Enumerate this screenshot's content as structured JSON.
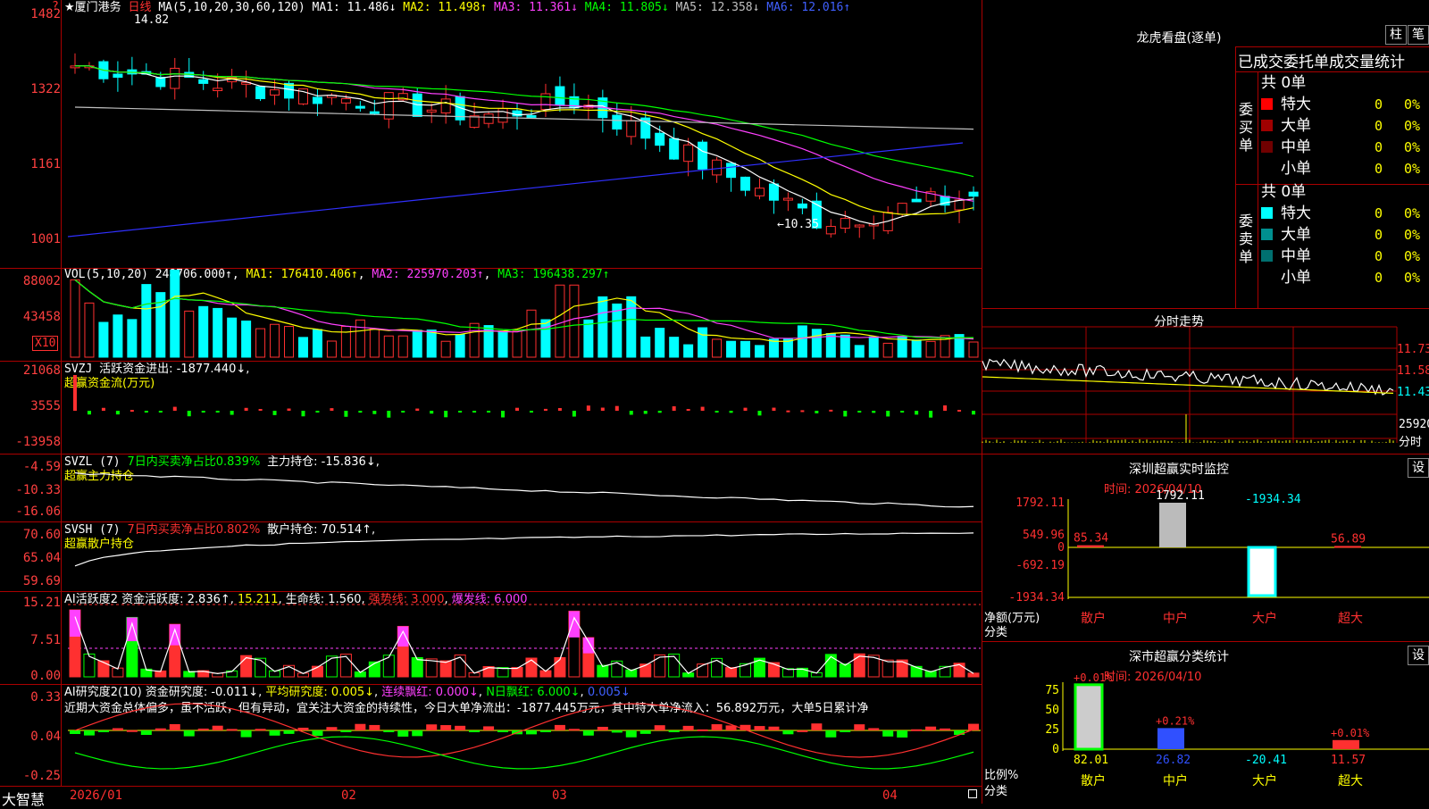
{
  "main_chart": {
    "title": "★厦门港务",
    "period": "日线",
    "ma_header": "MA(5,10,20,30,60,120)",
    "ma_values": [
      {
        "label": "MA1: 11.486↓",
        "color": "#ffffff"
      },
      {
        "label": "MA2: 11.498↑",
        "color": "#ffff00"
      },
      {
        "label": "MA3: 11.361↓",
        "color": "#ff40ff"
      },
      {
        "label": "MA4: 11.805↓",
        "color": "#00ff00"
      },
      {
        "label": "MA5: 12.358↓",
        "color": "#c0c0c0"
      },
      {
        "label": "MA6: 12.016↑",
        "color": "#4060ff"
      }
    ],
    "axis_labels": [
      "1482",
      "1322",
      "1161",
      "1001"
    ],
    "high_annotation": "14.82",
    "low_annotation": "←10.35"
  },
  "volume_pane": {
    "header": "VOL(5,10,20)",
    "value": "248706.000↑",
    "ma1": "MA1: 176410.406↑",
    "ma2": "MA2: 225970.203↑",
    "ma3": "MA3: 196438.297↑",
    "axis_labels": [
      "88002",
      "43458"
    ],
    "multiplier": "X10"
  },
  "svzj_pane": {
    "header": "SVZJ",
    "desc": "活跃资金进出: -1877.440↓,",
    "subtitle": "超赢资金流(万元)",
    "axis_labels": [
      "21068",
      "3555",
      "-13958"
    ]
  },
  "svzl_pane": {
    "header": "SVZL (7)",
    "desc": "7日内买卖净占比0.839%",
    "hold": "主力持仓: -15.836↓,",
    "subtitle": "超赢主力持仓",
    "axis_labels": [
      "-4.59",
      "-10.33",
      "-16.06"
    ]
  },
  "svsh_pane": {
    "header": "SVSH (7)",
    "desc": "7日内买卖净占比0.802%",
    "hold": "散户持仓: 70.514↑,",
    "subtitle": "超赢散户持仓",
    "axis_labels": [
      "70.60",
      "65.04",
      "59.69"
    ]
  },
  "ai_active_pane": {
    "header": "AI活跃度2",
    "v1": "资金活跃度: 2.836↑",
    "v2": "15.211",
    "v3": "生命线: 1.560",
    "v4": "强势线: 3.000",
    "v5": "爆发线: 6.000",
    "axis_labels": [
      "15.21",
      "7.51",
      "0.00"
    ]
  },
  "ai_research_pane": {
    "header": "AI研究度2(10)",
    "v1": "资金研究度: -0.011↓",
    "v2": "平均研究度: 0.005↓",
    "v3": "连续飘红: 0.000↓",
    "v4": "N日飘红: 6.000↓",
    "v5": "0.005↓",
    "comment": "近期大资金总体偏多，虽不活跃，但有异动，宜关注大资金的持续性，今日大单净流出：-1877.445万元，其中特大单净流入：56.892万元，大单5日累计净",
    "axis_labels": [
      "0.33",
      "0.04",
      "-0.25"
    ]
  },
  "x_axis": [
    "2026/01",
    "02",
    "03",
    "04"
  ],
  "footer_brand": "大智慧",
  "corner_icon": "?",
  "right_panel": {
    "dragon": {
      "title": "龙虎看盘(逐单)",
      "btn_bar": "柱",
      "btn_pen": "笔",
      "subtitle": "已成交委托单成交量统计",
      "buy": {
        "side_label": "委买单",
        "total": "共 0单",
        "rows": [
          {
            "label": "特大",
            "value": "0",
            "pct": "0%",
            "color": "#ff0000"
          },
          {
            "label": "大单",
            "value": "0",
            "pct": "0%",
            "color": "#a00000"
          },
          {
            "label": "中单",
            "value": "0",
            "pct": "0%",
            "color": "#700000"
          },
          {
            "label": "小单",
            "value": "0",
            "pct": "0%",
            "color": "#000000"
          }
        ]
      },
      "sell": {
        "side_label": "委卖单",
        "total": "共 0单",
        "rows": [
          {
            "label": "特大",
            "value": "0",
            "pct": "0%",
            "color": "#00ffff"
          },
          {
            "label": "大单",
            "value": "0",
            "pct": "0%",
            "color": "#009090"
          },
          {
            "label": "中单",
            "value": "0",
            "pct": "0%",
            "color": "#007070"
          },
          {
            "label": "小单",
            "value": "0",
            "pct": "0%",
            "color": "#000000"
          }
        ]
      }
    },
    "intraday": {
      "title": "分时走势",
      "axis_labels": [
        "11.73",
        "11.58",
        "11.43",
        "25920"
      ],
      "unit": "分时"
    },
    "monitor": {
      "title": "深圳超赢实时监控",
      "btn": "设",
      "time": "时间: 2026/04/10",
      "axis_labels": [
        "1792.11",
        "549.96",
        "0",
        "-692.19",
        "-1934.34"
      ],
      "y_unit": "净额(万元)",
      "x_unit": "分类",
      "bars": [
        {
          "cat": "散户",
          "value": "85.34"
        },
        {
          "cat": "中户",
          "value": "1792.11"
        },
        {
          "cat": "大户",
          "value": "-1934.34"
        },
        {
          "cat": "超大",
          "value": "56.89"
        }
      ]
    },
    "classify": {
      "title": "深市超赢分类统计",
      "btn": "设",
      "time": "时间: 2026/04/10",
      "axis_labels": [
        "75",
        "50",
        "25",
        "0"
      ],
      "y_unit": "比例%",
      "x_unit": "分类",
      "bars": [
        {
          "cat": "散户",
          "value": "82.01",
          "pct": "+0.01%"
        },
        {
          "cat": "中户",
          "value": "26.82",
          "pct": "+0.21%"
        },
        {
          "cat": "大户",
          "value": "-20.41",
          "pct": ""
        },
        {
          "cat": "超大",
          "value": "11.57",
          "pct": "+0.01%"
        }
      ]
    }
  }
}
